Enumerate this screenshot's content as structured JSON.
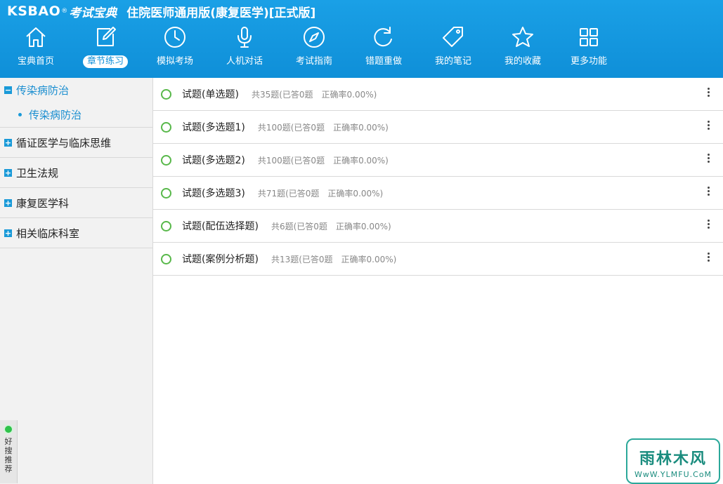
{
  "header": {
    "logo": "KSBAO",
    "logo_reg": "®",
    "logo_cn": "考试宝典",
    "app_title": "住院医师通用版(康复医学)[正式版]",
    "accent_color": "#1aa0e6"
  },
  "nav": [
    {
      "label": "宝典首页",
      "icon": "home-icon"
    },
    {
      "label": "章节练习",
      "icon": "edit-icon",
      "active": true
    },
    {
      "label": "模拟考场",
      "icon": "clock-icon"
    },
    {
      "label": "人机对话",
      "icon": "microphone-icon"
    },
    {
      "label": "考试指南",
      "icon": "compass-icon"
    },
    {
      "label": "错题重做",
      "icon": "refresh-icon"
    },
    {
      "label": "我的笔记",
      "icon": "tag-icon"
    },
    {
      "label": "我的收藏",
      "icon": "star-icon"
    },
    {
      "label": "更多功能",
      "icon": "grid-icon"
    }
  ],
  "sidebar": {
    "groups": [
      {
        "label": "传染病防治",
        "expanded": true,
        "sub": [
          "传染病防治"
        ]
      },
      {
        "label": "循证医学与临床思维",
        "expanded": false
      },
      {
        "label": "卫生法规",
        "expanded": false
      },
      {
        "label": "康复医学科",
        "expanded": false
      },
      {
        "label": "相关临床科室",
        "expanded": false
      }
    ],
    "recommend": [
      "好",
      "搜",
      "推",
      "荐"
    ]
  },
  "items": [
    {
      "name": "试题(单选题)",
      "stat": "共35题(已答0题　正确率0.00%)"
    },
    {
      "name": "试题(多选题1)",
      "stat": "共100题(已答0题　正确率0.00%)"
    },
    {
      "name": "试题(多选题2)",
      "stat": "共100题(已答0题　正确率0.00%)"
    },
    {
      "name": "试题(多选题3)",
      "stat": "共71题(已答0题　正确率0.00%)"
    },
    {
      "name": "试题(配伍选择题)",
      "stat": "共6题(已答0题　正确率0.00%)"
    },
    {
      "name": "试题(案例分析题)",
      "stat": "共13题(已答0题　正确率0.00%)"
    }
  ],
  "watermark": {
    "big": "雨林木风",
    "small": "WwW.YLMFU.CoM"
  }
}
